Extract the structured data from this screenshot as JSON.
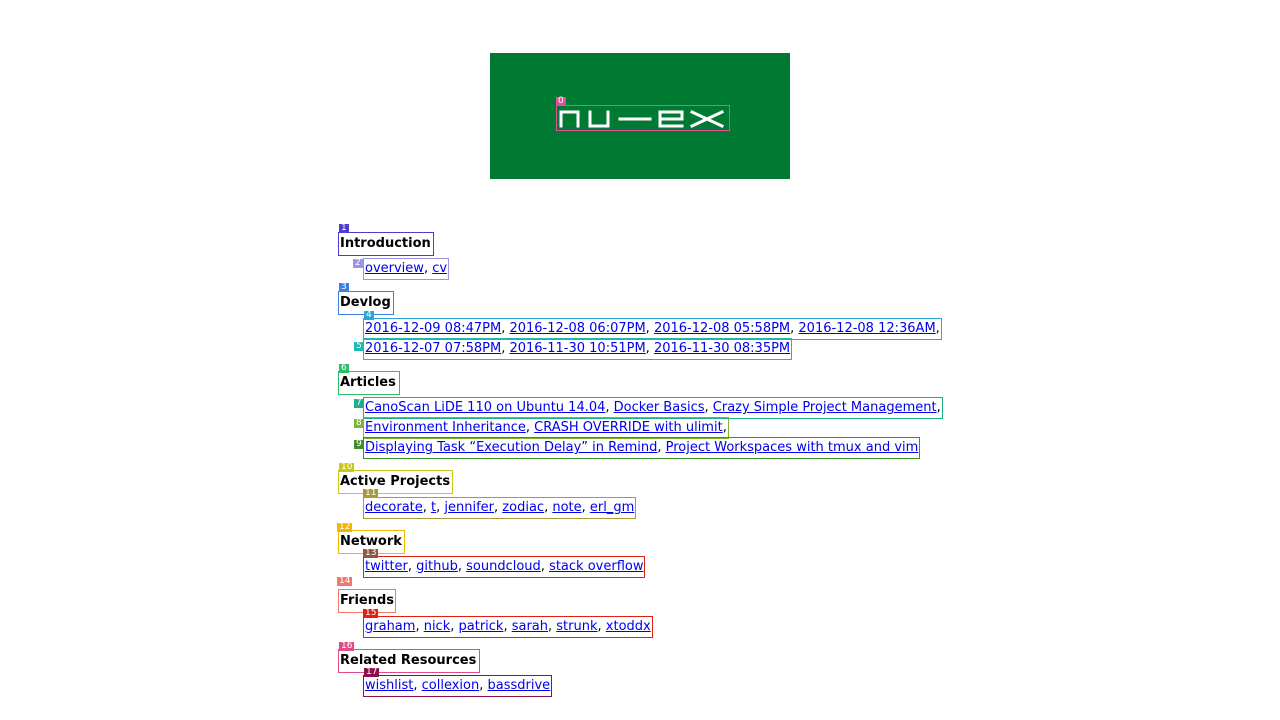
{
  "site": {
    "logo_text": "nu-ex",
    "banner_color": "#007a33"
  },
  "sections": [
    {
      "heading": "Introduction",
      "rows": [
        [
          "overview",
          "cv"
        ]
      ]
    },
    {
      "heading": "Devlog",
      "rows": [
        [
          "2016-12-09 08:47PM",
          "2016-12-08 06:07PM",
          "2016-12-08 05:58PM",
          "2016-12-08 12:36AM"
        ],
        [
          "2016-12-07 07:58PM",
          "2016-11-30 10:51PM",
          "2016-11-30 08:35PM"
        ]
      ]
    },
    {
      "heading": "Articles",
      "rows": [
        [
          "CanoScan LiDE 110 on Ubuntu 14.04",
          "Docker Basics",
          "Crazy Simple Project Management"
        ],
        [
          "Environment Inheritance",
          "CRASH OVERRIDE with ulimit"
        ],
        [
          "Displaying Task “Execution Delay” in Remind",
          "Project Workspaces with tmux and vim"
        ]
      ]
    },
    {
      "heading": "Active Projects",
      "rows": [
        [
          "decorate",
          "t",
          "jennifer",
          "zodiac",
          "note",
          "erl_gm"
        ]
      ]
    },
    {
      "heading": "Network",
      "rows": [
        [
          "twitter",
          "github",
          "soundcloud",
          "stack overflow"
        ]
      ]
    },
    {
      "heading": "Friends",
      "rows": [
        [
          "graham",
          "nick",
          "patrick",
          "sarah",
          "strunk",
          "xtoddx"
        ]
      ]
    },
    {
      "heading": "Related Resources",
      "rows": [
        [
          "wishlist",
          "collexion",
          "bassdrive"
        ]
      ]
    }
  ],
  "overlay_tags": [
    "0",
    "1",
    "2",
    "3",
    "4",
    "5",
    "6",
    "7",
    "8",
    "9",
    "10",
    "11",
    "12",
    "13",
    "14",
    "15",
    "16",
    "17"
  ],
  "overlay_colors": [
    "#e0509a",
    "#4b3cd6",
    "#9a93e8",
    "#3b82e0",
    "#2aa6d9",
    "#20b8b0",
    "#2bbf6a",
    "#1fae88",
    "#7ab82e",
    "#3e8e2a",
    "#c9c91a",
    "#a89a3a",
    "#f2b700",
    "#8a5a44",
    "#f07868",
    "#e02010",
    "#e04b8a",
    "#8a1050"
  ]
}
